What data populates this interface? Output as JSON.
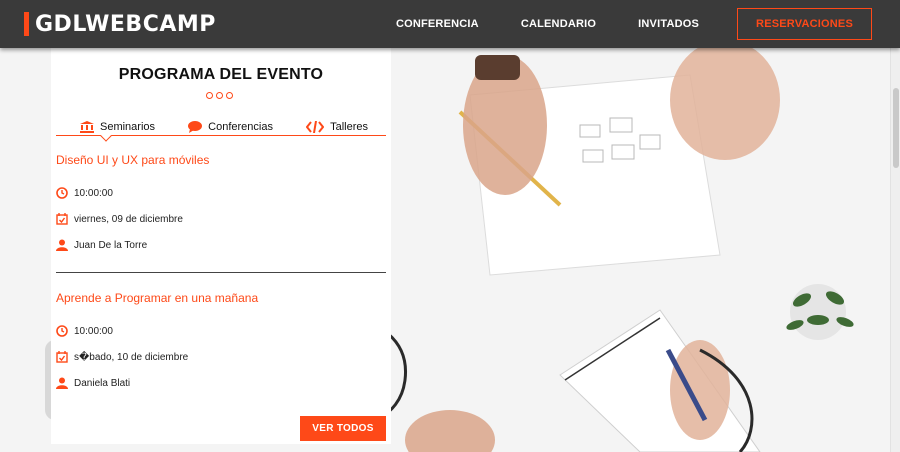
{
  "header": {
    "logo": "GDLWEBCAMP",
    "nav": [
      "CONFERENCIA",
      "CALENDARIO",
      "INVITADOS"
    ],
    "cta": "RESERVACIONES"
  },
  "program": {
    "title": "PROGRAMA DEL EVENTO",
    "tabs": [
      {
        "label": "Seminarios",
        "icon": "bank-icon"
      },
      {
        "label": "Conferencias",
        "icon": "speech-bubble-icon"
      },
      {
        "label": "Talleres",
        "icon": "code-icon"
      }
    ],
    "events": [
      {
        "title": "Diseño UI y UX para móviles",
        "time": "10:00:00",
        "date": "viernes, 09 de diciembre",
        "speaker": "Juan De la Torre"
      },
      {
        "title": "Aprende a Programar en una mañana",
        "time": "10:00:00",
        "date": "s�bado, 10 de diciembre",
        "speaker": "Daniela Blati"
      }
    ],
    "button": "VER TODOS"
  },
  "colors": {
    "accent": "#fe4918",
    "header_bg": "#3a3a3a"
  }
}
